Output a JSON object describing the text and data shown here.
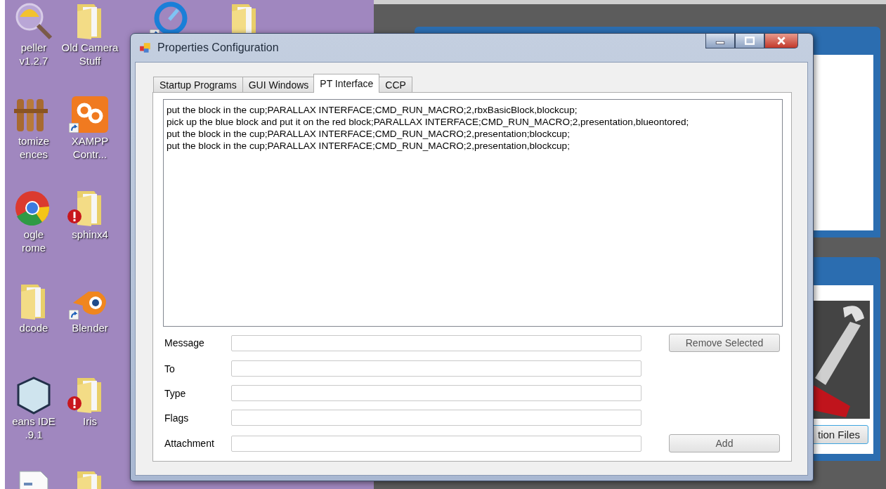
{
  "desktop": {
    "columns": [
      [
        {
          "kind": "magnifier",
          "label": [
            "peller",
            "v1.2.7"
          ],
          "shortcut": false,
          "warning": false
        },
        {
          "kind": "fence",
          "label": [
            "tomize",
            "ences"
          ],
          "shortcut": false,
          "warning": false
        },
        {
          "kind": "chrome",
          "label": [
            "ogle",
            "rome"
          ],
          "shortcut": false,
          "warning": false
        },
        {
          "kind": "folder",
          "label": [
            "dcode"
          ],
          "shortcut": false,
          "warning": false
        },
        {
          "kind": "cube",
          "label": [
            "eans IDE",
            ".9.1"
          ],
          "shortcut": false,
          "warning": false
        },
        {
          "kind": "document",
          "shortcut": false,
          "warning": false
        }
      ],
      [
        {
          "kind": "folder",
          "label": [
            "Old Camera",
            "Stuff"
          ],
          "shortcut": false,
          "warning": false
        },
        {
          "kind": "xampp",
          "label": [
            "XAMPP",
            "Contr..."
          ],
          "shortcut": true,
          "warning": false
        },
        {
          "kind": "folder",
          "label": [
            "sphinx4"
          ],
          "shortcut": false,
          "warning": true
        },
        {
          "kind": "blender",
          "label": [
            "Blender"
          ],
          "shortcut": true,
          "warning": false
        },
        {
          "kind": "folder",
          "label": [
            "Iris"
          ],
          "shortcut": false,
          "warning": true
        },
        {
          "kind": "folder",
          "shortcut": false,
          "warning": false
        }
      ],
      [
        {
          "kind": "quicktime",
          "shortcut": true,
          "warning": false
        }
      ],
      [
        {
          "kind": "folder",
          "shortcut": false,
          "warning": false
        }
      ]
    ]
  },
  "background_window": {
    "button": "tion Files"
  },
  "dialog": {
    "title": "Properties Configuration",
    "tabs": [
      {
        "label": "Startup Programs",
        "selected": false
      },
      {
        "label": "GUI Windows",
        "selected": false
      },
      {
        "label": "PT Interface",
        "selected": true
      },
      {
        "label": "CCP",
        "selected": false
      }
    ],
    "lines": [
      "put the block in the cup;PARALLAX INTERFACE;CMD_RUN_MACRO;2,rbxBasicBlock,blockcup;",
      "pick up the blue block and put it on the red block;PARALLAX INTERFACE;CMD_RUN_MACRO;2,presentation,blueontored;",
      "put the block in the cup;PARALLAX INTERFACE;CMD_RUN_MACRO;2,presentation;blockcup;",
      "put the block in the cup;PARALLAX INTERFACE;CMD_RUN_MACRO;2,presentation,blockcup;"
    ],
    "fields": [
      {
        "label": "Message",
        "button": "Remove Selected"
      },
      {
        "label": "To"
      },
      {
        "label": "Type"
      },
      {
        "label": "Flags"
      },
      {
        "label": "Attachment",
        "button": "Add"
      }
    ]
  }
}
